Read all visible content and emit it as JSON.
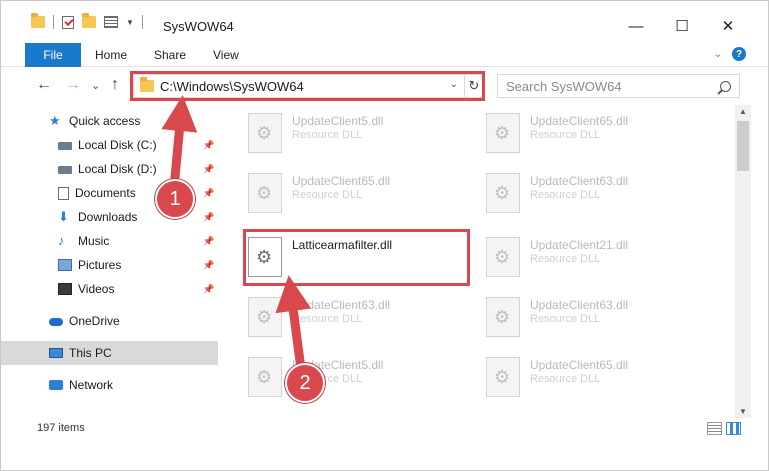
{
  "window": {
    "title": "SysWOW64",
    "minimize_glyph": "—",
    "maximize_glyph": "☐",
    "close_glyph": "✕"
  },
  "ribbon": {
    "tabs": [
      "File",
      "Home",
      "Share",
      "View"
    ],
    "collapse_glyph": "⌄",
    "help_glyph": "?"
  },
  "nav": {
    "back_glyph": "←",
    "forward_glyph": "→",
    "recent_glyph": "⌄",
    "up_glyph": "↑",
    "address": "C:\\Windows\\SysWOW64",
    "address_drop_glyph": "⌄",
    "refresh_glyph": "↻",
    "search_placeholder": "Search SysWOW64"
  },
  "sidebar": {
    "quick_access": "Quick access",
    "items": [
      {
        "label": "Local Disk (C:)",
        "icon": "drive-icon",
        "pinned": true
      },
      {
        "label": "Local Disk (D:)",
        "icon": "drive-icon",
        "pinned": true
      },
      {
        "label": "Documents",
        "icon": "documents-icon",
        "pinned": true
      },
      {
        "label": "Downloads",
        "icon": "downloads-icon",
        "pinned": true
      },
      {
        "label": "Music",
        "icon": "music-icon",
        "pinned": true
      },
      {
        "label": "Pictures",
        "icon": "pictures-icon",
        "pinned": true
      },
      {
        "label": "Videos",
        "icon": "videos-icon",
        "pinned": true
      }
    ],
    "onedrive": "OneDrive",
    "this_pc": "This PC",
    "network": "Network"
  },
  "files": [
    {
      "name": "UpdateClient5.dll",
      "type": "Resource DLL"
    },
    {
      "name": "UpdateClient65.dll",
      "type": "Resource DLL"
    },
    {
      "name": "UpdateClient65.dll",
      "type": "Resource DLL"
    },
    {
      "name": "UpdateClient63.dll",
      "type": "Resource DLL"
    },
    {
      "name": "Latticearmafilter.dll",
      "type": ""
    },
    {
      "name": "UpdateClient21.dll",
      "type": "Resource DLL"
    },
    {
      "name": "UpdateClient63.dll",
      "type": "Resource DLL"
    },
    {
      "name": "UpdateClient63.dll",
      "type": "Resource DLL"
    },
    {
      "name": "UpdateClient5.dll",
      "type": "Resource DLL"
    },
    {
      "name": "UpdateClient65.dll",
      "type": "Resource DLL"
    }
  ],
  "status": {
    "item_count": "197 items"
  },
  "callouts": [
    "1",
    "2"
  ],
  "colors": {
    "accent": "#1979ca",
    "highlight": "#d9484d"
  }
}
